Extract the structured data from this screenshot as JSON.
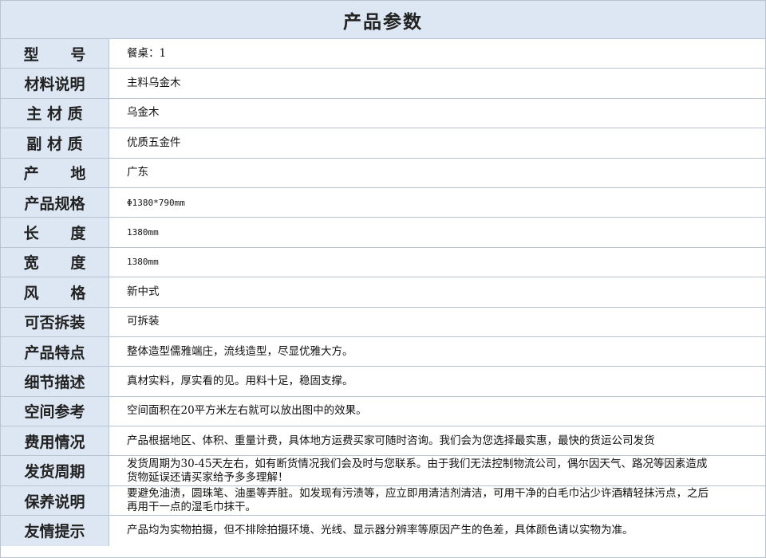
{
  "title": "产品参数",
  "rows": [
    {
      "label": "型      号",
      "value": "餐桌：1"
    },
    {
      "label": "材料说明",
      "value": "主料乌金木"
    },
    {
      "label": "主 材 质",
      "value": "乌金木"
    },
    {
      "label": "副 材 质",
      "value": "优质五金件"
    },
    {
      "label": "产      地",
      "value": "广东"
    },
    {
      "label": "产品规格",
      "value": "Φ1380*790mm"
    },
    {
      "label": "长      度",
      "value": "1380mm"
    },
    {
      "label": "宽      度",
      "value": "1380mm"
    },
    {
      "label": "风      格",
      "value": "新中式"
    },
    {
      "label": "可否拆装",
      "value": "可拆装"
    },
    {
      "label": "产品特点",
      "value": "整体造型儒雅端庄，流线造型，尽显优雅大方。"
    },
    {
      "label": "细节描述",
      "value": "真材实料，厚实看的见。用料十足，稳固支撑。"
    },
    {
      "label": "空间参考",
      "value": "空间面积在20平方米左右就可以放出图中的效果。"
    },
    {
      "label": "费用情况",
      "value": "产品根据地区、体积、重量计费，具体地方运费买家可随时咨询。我们会为您选择最实惠，最快的货运公司发货"
    },
    {
      "label": "发货周期",
      "value": "发货周期为30-45天左右，如有断货情况我们会及时与您联系。由于我们无法控制物流公司，偶尔因天气、路况等因素造成货物延误还请买家给予多多理解！"
    },
    {
      "label": "保养说明",
      "value": "要避免油渍，圆珠笔、油墨等弄脏。如发现有污渍等，应立即用清洁剂清洁，可用干净的白毛巾沾少许酒精轻抹污点，之后再用干一点的湿毛巾抹干。"
    },
    {
      "label": "友情提示",
      "value": "产品均为实物拍摄，但不排除拍摄环境、光线、显示器分辨率等原因产生的色差，具体颜色请以实物为准。"
    }
  ]
}
